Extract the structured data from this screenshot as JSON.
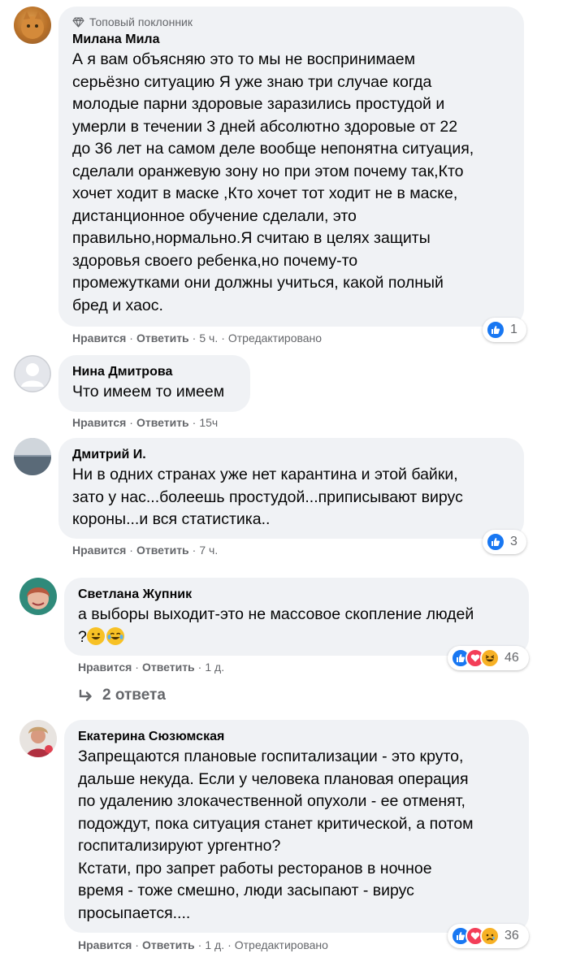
{
  "comments": [
    {
      "badge": "Топовый поклонник",
      "author": "Милана Мила",
      "text": "А я вам объясняю это то мы не воспринимаем\nсерьёзно ситуацию Я уже знаю три случае когда\nмолодые парни здоровые заразились простудой и\nумерли в течении 3 дней абсолютно здоровые от 22\nдо 36 лет на самом деле вообще непонятна ситуация,\nсделали оранжевую зону но при этом почему так,Кто\nхочет ходит в маске ,Кто хочет тот ходит не в маске,\nдистанционное обучение сделали, это\nправильно,нормально.Я считаю в целях защиты\nздоровья своего ребенка,но почему-то\nпромежутками они должны учиться, какой полный\nбред и хаос.",
      "like": "Нравится",
      "reply": "Ответить",
      "time": "5 ч.",
      "edited": "Отредактировано",
      "reaction_count": "1"
    },
    {
      "author": "Нина Дмитрова",
      "text": "Что имеем то имеем",
      "like": "Нравится",
      "reply": "Ответить",
      "time": "15ч"
    },
    {
      "author": "Дмитрий И.",
      "text": "Ни в одних странах уже нет карантина и этой байки,\nзато у нас...болеешь простудой...приписывают вирус\nкороны...и вся статистика..",
      "like": "Нравится",
      "reply": "Ответить",
      "time": "7 ч.",
      "reaction_count": "3"
    },
    {
      "author": "Светлана Жупник",
      "text": "а выборы выходит-это не массовое скопление людей\n?",
      "like": "Нравится",
      "reply": "Ответить",
      "time": "1 д.",
      "reaction_count": "46",
      "replies": "2 ответа"
    },
    {
      "author": "Екатерина Сюзюмская",
      "text": "Запрещаются плановые госпитализации - это круто,\nдальше некуда. Если у человека плановая операция\nпо удалению злокачественной опухоли - ее отменят,\nподождут, пока ситуация станет критической, а потом\nгоспитализируют ургентно?\nКстати, про запрет работы ресторанов в ночное\nвремя - тоже смешно, люди засыпают - вирус\nпросыпается....",
      "like": "Нравится",
      "reply": "Ответить",
      "time": "1 д.",
      "edited": "Отредактировано",
      "reaction_count": "36"
    }
  ],
  "colors": {
    "bubble": "#f0f2f5",
    "meta": "#65676b",
    "like_blue": "#1877f2",
    "love_red": "#f33e58",
    "emoji_yellow": "#f7b125"
  }
}
